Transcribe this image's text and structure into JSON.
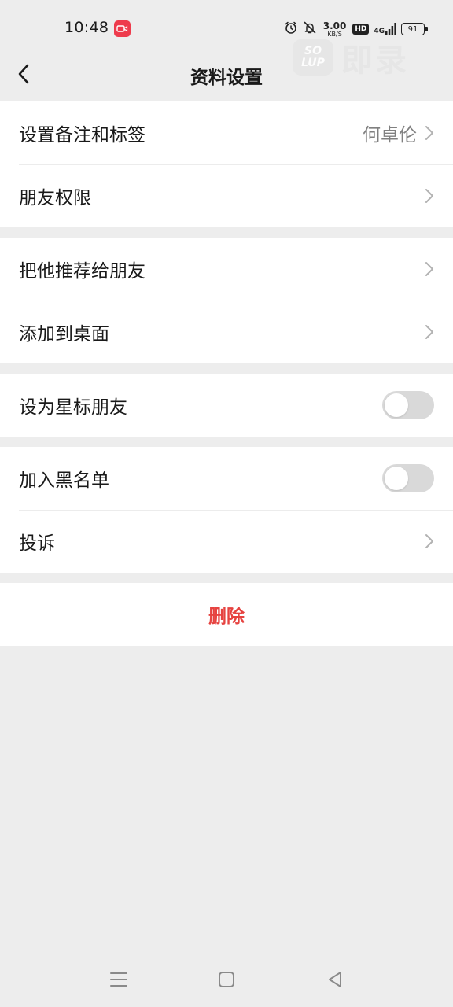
{
  "status_bar": {
    "time": "10:48",
    "speed_value": "3.00",
    "speed_unit": "KB/S",
    "hd": "HD",
    "network": "4G",
    "battery": "91",
    "icons": [
      "screen-record-icon",
      "alarm-icon",
      "mute-bell-icon",
      "signal-icon",
      "battery-icon"
    ]
  },
  "watermark": {
    "logo_line1": "SO",
    "logo_line2": "LUP",
    "text": "即录"
  },
  "nav": {
    "title": "资料设置",
    "back_icon": "chevron-left-icon"
  },
  "groups": [
    {
      "items": [
        {
          "label": "设置备注和标签",
          "value": "何卓伦",
          "type": "link"
        },
        {
          "label": "朋友权限",
          "type": "link"
        }
      ]
    },
    {
      "items": [
        {
          "label": "把他推荐给朋友",
          "type": "link"
        },
        {
          "label": "添加到桌面",
          "type": "link"
        }
      ]
    },
    {
      "items": [
        {
          "label": "设为星标朋友",
          "type": "toggle",
          "on": false
        }
      ]
    },
    {
      "items": [
        {
          "label": "加入黑名单",
          "type": "toggle",
          "on": false
        },
        {
          "label": "投诉",
          "type": "link"
        }
      ]
    }
  ],
  "delete": {
    "label": "删除"
  },
  "colors": {
    "background": "#ededed",
    "cell": "#ffffff",
    "danger": "#e64340",
    "toggle_off": "#d9d9d9",
    "secondary_text": "#808080"
  },
  "system_nav": [
    "menu-icon",
    "home-icon",
    "back-triangle-icon"
  ]
}
